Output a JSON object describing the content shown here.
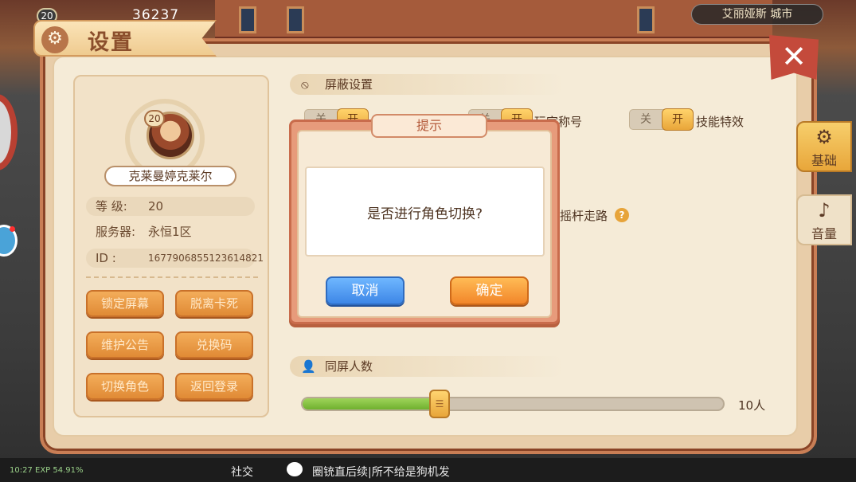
{
  "hud": {
    "level": "20",
    "gold": "36237",
    "location": "艾丽娅斯 城市",
    "status_bar": "10:27 EXP 54.91%",
    "social_label": "社交",
    "chat_message": "圈铳直后续|所不给是狗机发"
  },
  "panel": {
    "title": "设置",
    "close_glyph": "✕"
  },
  "profile": {
    "avatar_level": "20",
    "name": "克莱曼婷克莱尔",
    "level_label": "等  级:",
    "level_value": "20",
    "server_label": "服务器:",
    "server_value": "永恒1区",
    "id_label": "ID  :",
    "id_value": "1677906855123614821",
    "buttons": [
      "锁定屏幕",
      "脱离卡死",
      "维护公告",
      "兑换码",
      "切换角色",
      "返回登录"
    ]
  },
  "block_settings": {
    "header": "屏蔽设置",
    "toggle_off": "关",
    "toggle_on": "开",
    "items": [
      {
        "label": "玩家称号"
      },
      {
        "label": "技能特效"
      },
      {
        "label": "摇杆走路"
      }
    ]
  },
  "screen_people": {
    "header": "同屏人数",
    "value_label": "10人",
    "fill_fraction": 0.32,
    "thumb_glyph": "☰"
  },
  "side_tabs": [
    {
      "label": "基础",
      "glyph": "⚙",
      "active": true
    },
    {
      "label": "音量",
      "glyph": "♪",
      "active": false
    }
  ],
  "dialog": {
    "title": "提示",
    "message": "是否进行角色切换?",
    "cancel": "取消",
    "confirm": "确定"
  },
  "colors": {
    "panel_border": "#c97e55",
    "accent_orange": "#e08a35",
    "cancel_blue": "#3d86e6",
    "confirm_orange": "#f2862a",
    "slider_green": "#6fb02e"
  }
}
